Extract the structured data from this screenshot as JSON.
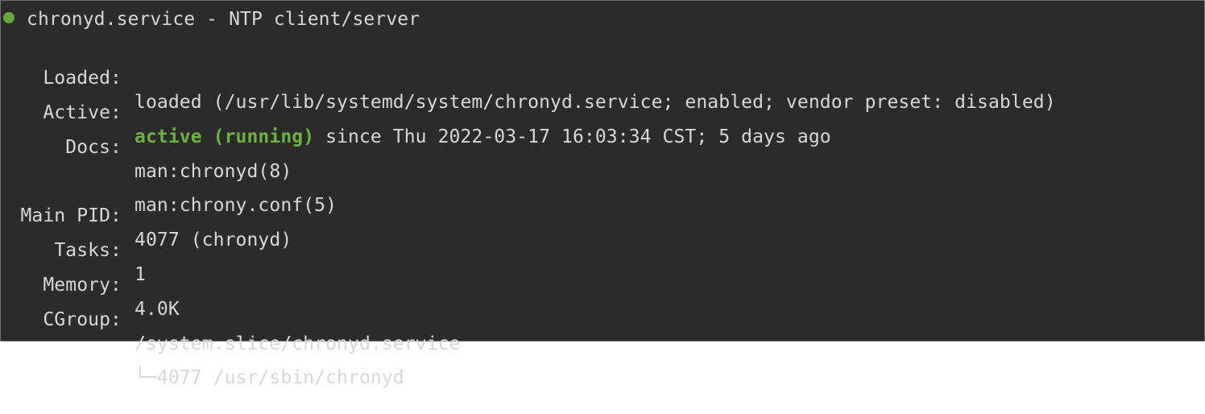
{
  "status": {
    "indicator_color": "#67a83f",
    "service_name": "chronyd.service",
    "separator": " - ",
    "description": "NTP client/server",
    "rows": [
      {
        "key": "loaded",
        "label": "Loaded:",
        "value": "loaded (/usr/lib/systemd/system/chronyd.service; enabled; vendor preset: disabled)"
      },
      {
        "key": "active",
        "label": "Active:",
        "state": "active (running)",
        "rest": " since Thu 2022-03-17 16:03:34 CST; 5 days ago"
      },
      {
        "key": "docs",
        "label": "Docs:",
        "value": "man:chronyd(8)"
      },
      {
        "key": "docs2",
        "label": "",
        "value": "man:chrony.conf(5)"
      },
      {
        "key": "pid",
        "label": "Main PID:",
        "value": "4077 (chronyd)"
      },
      {
        "key": "tasks",
        "label": "Tasks:",
        "value": "1"
      },
      {
        "key": "memory",
        "label": "Memory:",
        "value": "4.0K"
      },
      {
        "key": "cgroup",
        "label": "CGroup:",
        "value": "/system.slice/chronyd.service"
      },
      {
        "key": "cgroup_child",
        "label": "",
        "value": "└─4077 /usr/sbin/chronyd"
      }
    ]
  }
}
